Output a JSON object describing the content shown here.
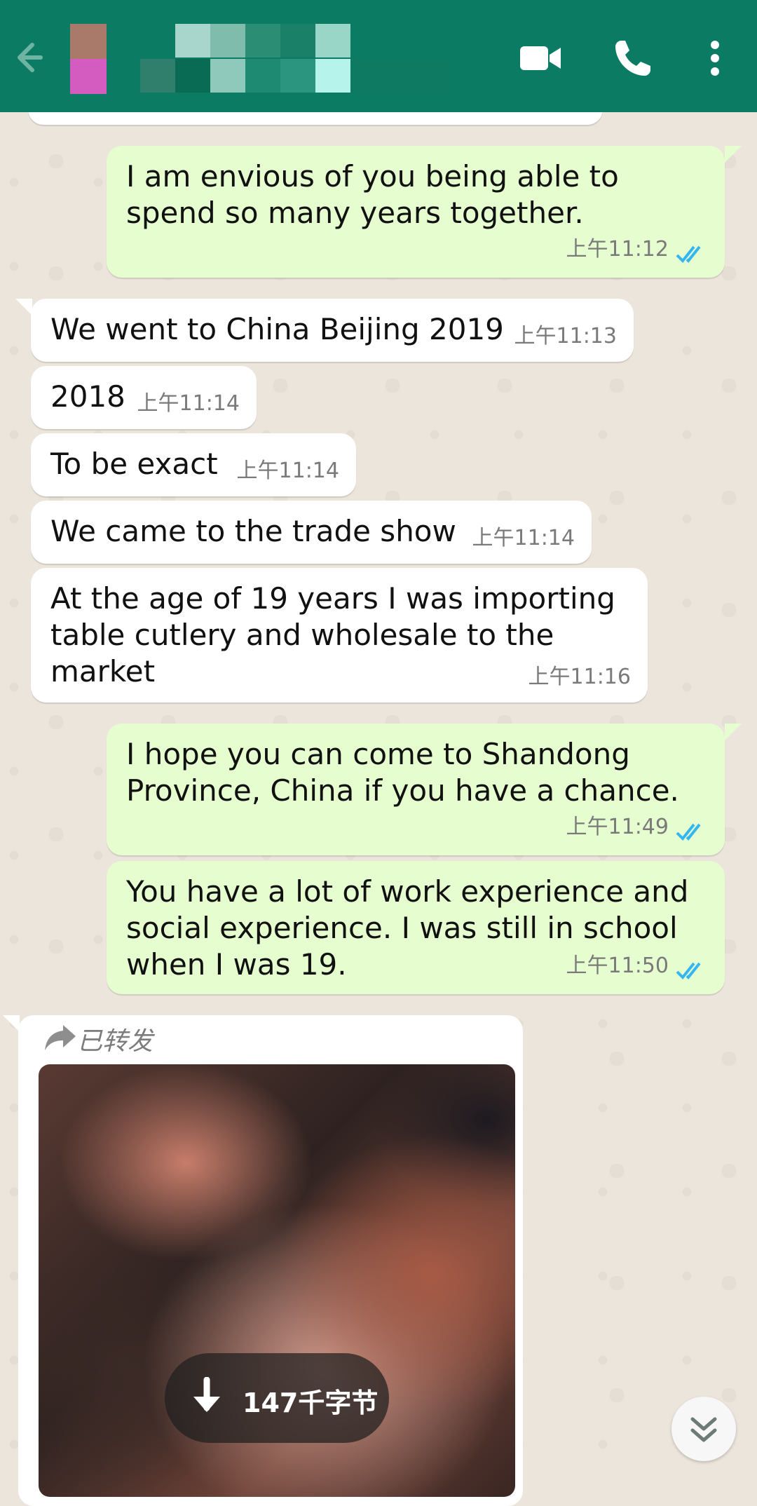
{
  "header": {
    "colors": {
      "bar": "#0b7b63",
      "icon": "#ffffff"
    },
    "icons": [
      "back-arrow-icon",
      "video-call-icon",
      "phone-icon",
      "more-vert-icon"
    ]
  },
  "messages": [
    {
      "dir": "out",
      "text": "I am envious of you being able to\nspend so many years together.",
      "time": "上午11:12",
      "read": true
    },
    {
      "dir": "in",
      "text": "We went to China Beijing 2019",
      "time": "上午11:13"
    },
    {
      "dir": "in",
      "text": "2018",
      "time": "上午11:14"
    },
    {
      "dir": "in",
      "text": "To be exact",
      "time": "上午11:14"
    },
    {
      "dir": "in",
      "text": "We came to the trade show",
      "time": "上午11:14"
    },
    {
      "dir": "in",
      "text": "At the age of 19 years I was importing\ntable cutlery and wholesale to the\nmarket",
      "time": "上午11:16"
    },
    {
      "dir": "out",
      "text": "I hope you can come to Shandong\nProvince, China if you have a chance.",
      "time": "上午11:49",
      "read": true
    },
    {
      "dir": "out",
      "text": "You have a lot of work experience and\nsocial experience. I was still in school\nwhen I was 19.",
      "time": "上午11:50",
      "read": true
    }
  ],
  "forwarded": {
    "label": "已转发",
    "size": "147千字节"
  },
  "colors": {
    "incoming": "#ffffff",
    "outgoing": "#e6fecf",
    "read_ticks": "#34b7f1",
    "time": "#7a7a7a"
  }
}
